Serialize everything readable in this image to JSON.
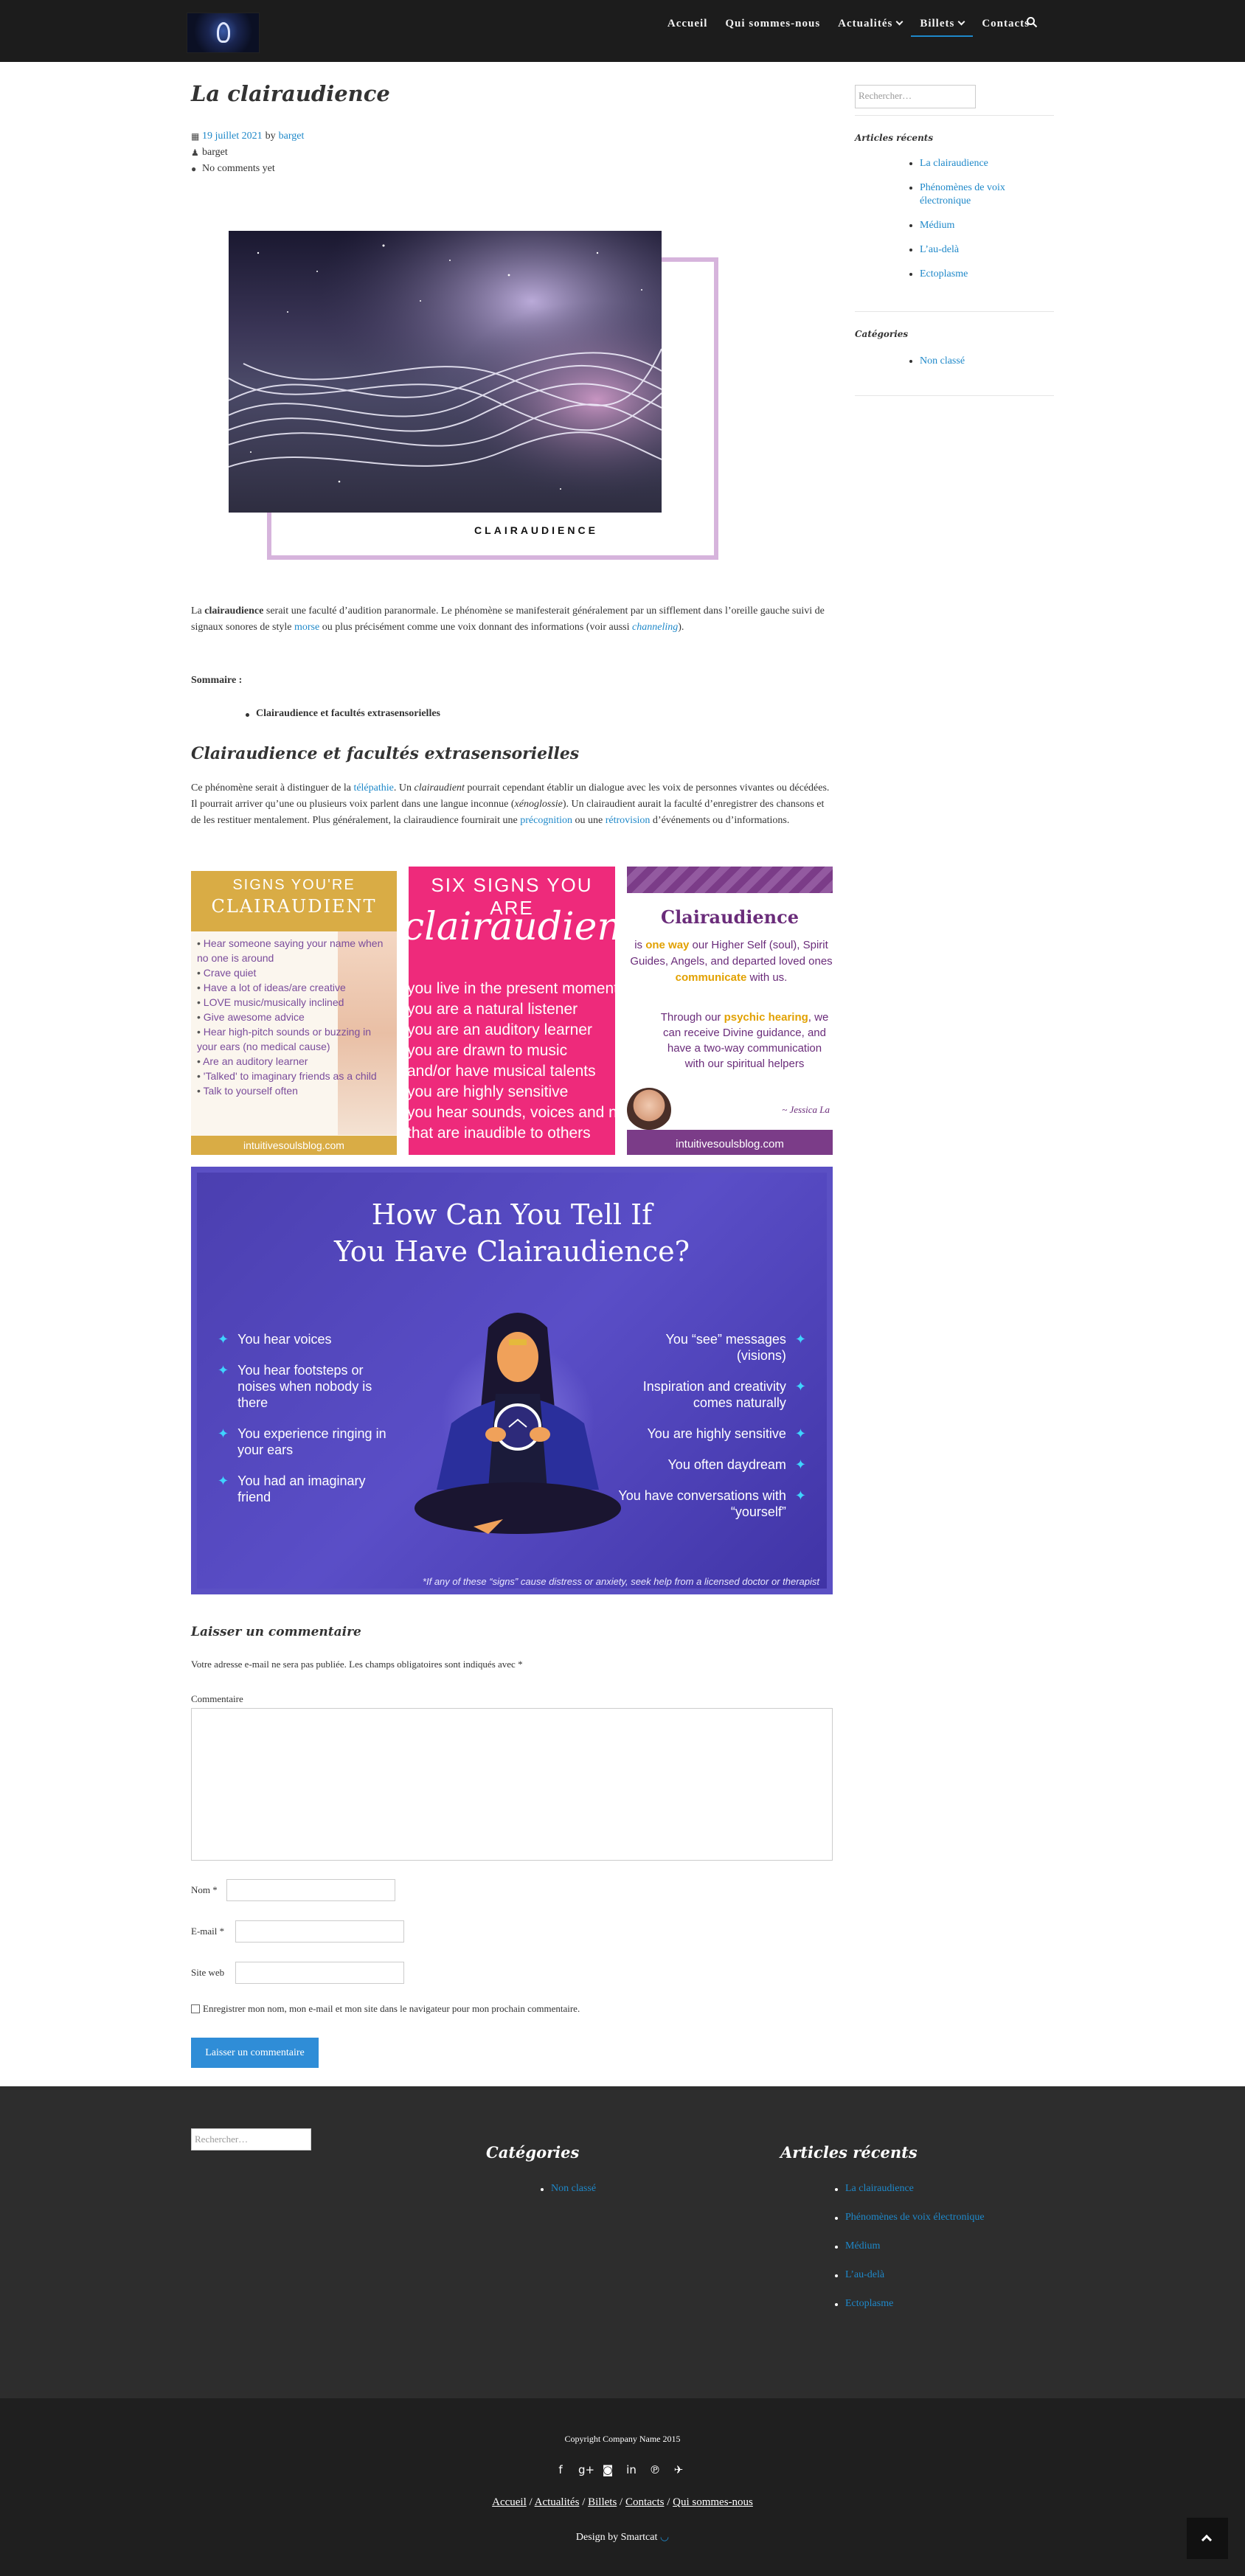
{
  "nav": {
    "items": [
      "Accueil",
      "Qui sommes-nous",
      "Actualités",
      "Billets",
      "Contacts"
    ],
    "active": "Billets",
    "search_icon": "search-icon"
  },
  "post": {
    "title": "La clairaudience",
    "date": "19 juillet 2021",
    "by": "by",
    "author": "barget",
    "author_line": "barget",
    "comments": "No comments yet",
    "image_caption": "CLAIRAUDIENCE",
    "p1_a": "La ",
    "p1_b": "clairaudience",
    "p1_c": " serait une faculté d’audition paranormale. Le phénomène se manifesterait généralement par un sifflement dans l’oreille gauche suivi de signaux sonores de style ",
    "p1_link1": "morse",
    "p1_d": " ou plus précisément comme une voix donnant des informations (voir aussi ",
    "p1_link2": "channeling",
    "p1_e": ").",
    "sommaire": "Sommaire :",
    "toc": [
      "Clairaudience et facultés extrasensorielles"
    ],
    "h2": "Clairaudience et facultés extrasensorielles",
    "p2_a": "Ce phénomène serait à distinguer de la ",
    "p2_link1": "télépathie",
    "p2_b": ". Un ",
    "p2_em1": "clairaudient",
    "p2_c": " pourrait cependant établir un dialogue avec les voix de personnes vivantes ou décédées. Il pourrait arriver qu’une ou plusieurs voix parlent dans une langue inconnue (",
    "p2_em2": "xénoglossie",
    "p2_d": "). Un clairaudient aurait la faculté d’enregistrer des chansons et de les restituer mentalement. Plus généralement, la clairaudience fournirait une ",
    "p2_link2": "précognition",
    "p2_e": " ou une ",
    "p2_link3": "rétrovision",
    "p2_f": " d’événements ou d’informations."
  },
  "infographic1": {
    "line1": "SIGNS YOU'RE",
    "line2": "CLAIRAUDIENT",
    "items": [
      "Hear someone saying your name when no one is around",
      "Crave quiet",
      "Have a lot of ideas/are creative",
      "LOVE music/musically inclined",
      "Give awesome advice",
      "Hear high-pitch sounds or buzzing in your ears (no medical cause)",
      "Are an auditory learner",
      "'Talked' to imaginary friends as a child",
      "Talk to yourself often"
    ],
    "footer": "intuitivesoulsblog.com"
  },
  "infographic2": {
    "line1": "SIX SIGNS YOU ARE",
    "line2": "clairaudient",
    "items": [
      "you live in the present moment",
      "you are a natural listener",
      "you are an auditory learner",
      "you are drawn to music",
      "and/or have musical talents",
      "you are highly sensitive",
      "you hear sounds, voices and noise",
      "that are inaudible to others"
    ]
  },
  "infographic3": {
    "title": "Clairaudience",
    "b1_a": "is ",
    "b1_hi1": "one way",
    "b1_b": " our Higher Self (soul), Spirit Guides, Angels, and departed loved ones ",
    "b1_hi2": "communicate",
    "b1_c": " with us.",
    "b2_a": "Through our ",
    "b2_hi": "psychic hearing",
    "b2_b": ", we can receive Divine guidance, and have a two-way communication with our spiritual helpers",
    "signature": "~ Jessica La",
    "site": "intuitivesoulsblog.com"
  },
  "infographic4": {
    "title_l1": "How Can You Tell If",
    "title_l2": "You Have Clairaudience?",
    "left": [
      "You hear voices",
      "You hear footsteps or noises when nobody is there",
      "You experience ringing in your ears",
      "You had an imaginary friend"
    ],
    "right": [
      "You “see” messages (visions)",
      "Inspiration and creativity comes naturally",
      "You are highly sensitive",
      "You often daydream",
      "You have conversations with “yourself”"
    ],
    "note": "*If any of these “signs” cause distress or anxiety, seek help from a licensed doctor or therapist"
  },
  "comment_form": {
    "title": "Laisser un commentaire",
    "note": "Votre adresse e-mail ne sera pas publiée. Les champs obligatoires sont indiqués avec *",
    "comment_label": "Commentaire",
    "name_label": "Nom *",
    "email_label": "E-mail *",
    "site_label": "Site web",
    "checkbox_label": "Enregistrer mon nom, mon e-mail et mon site dans le navigateur pour mon prochain commentaire.",
    "submit": "Laisser un commentaire"
  },
  "sidebar": {
    "search_placeholder": "Rechercher…",
    "recent_title": "Articles récents",
    "recent": [
      "La clairaudience",
      "Phénomènes de voix électronique",
      "Médium",
      "L’au-delà",
      "Ectoplasme"
    ],
    "cat_title": "Catégories",
    "categories": [
      "Non classé"
    ]
  },
  "footer": {
    "search_placeholder": "Rechercher…",
    "cat_title": "Catégories",
    "categories": [
      "Non classé"
    ],
    "recent_title": "Articles récents",
    "recent": [
      "La clairaudience",
      "Phénomènes de voix électronique",
      "Médium",
      "L’au-delà",
      "Ectoplasme"
    ],
    "copyright": "Copyright Company Name 2015",
    "links": [
      "Accueil",
      "Actualités",
      "Billets",
      "Contacts",
      "Qui sommes-nous"
    ],
    "design": "Design by Smartcat"
  }
}
